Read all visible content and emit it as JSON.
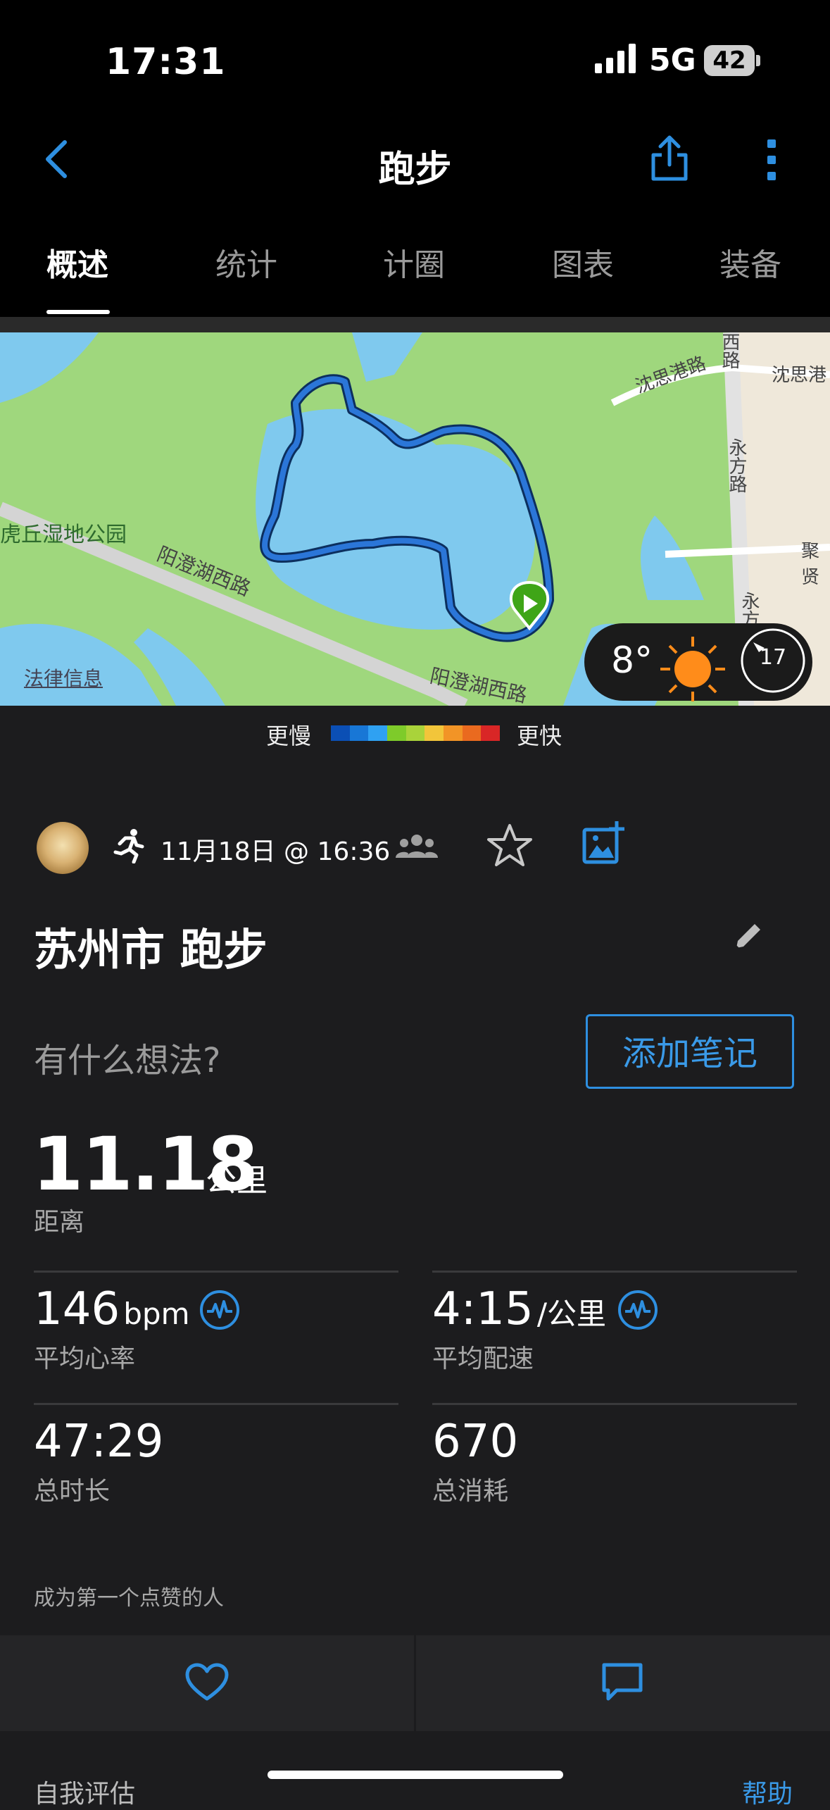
{
  "status_bar": {
    "time": "17:31",
    "network": "5G",
    "battery": "42"
  },
  "nav": {
    "title": "跑步"
  },
  "tabs": [
    "概述",
    "统计",
    "计圈",
    "图表",
    "装备"
  ],
  "map": {
    "roads": [
      "阳澄湖西路",
      "阳澄湖西路",
      "沈思港路",
      "沈思港",
      "永方路",
      "聚贤",
      "永方",
      "西路"
    ],
    "park_label": "虎丘湿地公园",
    "legal": "法律信息",
    "weather": {
      "temp": "8°",
      "wind": "17"
    }
  },
  "legend": {
    "slow": "更慢",
    "fast": "更快",
    "colors": [
      "#0b4fb5",
      "#1877d6",
      "#2fa1f2",
      "#7ecb2a",
      "#a9d33a",
      "#f2c53a",
      "#f29426",
      "#ea6a1f",
      "#d92626"
    ]
  },
  "activity": {
    "datetime": "11月18日 @ 16:36",
    "title": "苏州市 跑步",
    "note_prompt": "有什么想法?",
    "note_button": "添加笔记"
  },
  "stats": {
    "distance": {
      "value": "11.18",
      "unit": "公里",
      "label": "距离"
    },
    "heart_rate": {
      "value": "146",
      "unit": "bpm",
      "label": "平均心率"
    },
    "pace": {
      "value": "4:15",
      "unit": "/公里",
      "label": "平均配速"
    },
    "duration": {
      "value": "47:29",
      "label": "总时长"
    },
    "calories": {
      "value": "670",
      "label": "总消耗"
    }
  },
  "social": {
    "likes_text": "成为第一个点赞的人"
  },
  "footer": {
    "self_eval": "自我评估",
    "help": "帮助"
  },
  "colors": {
    "accent": "#2e8fe0",
    "route": "#2b76d8",
    "start_marker": "#3fa517",
    "weather_sun": "#ff8c1a"
  }
}
